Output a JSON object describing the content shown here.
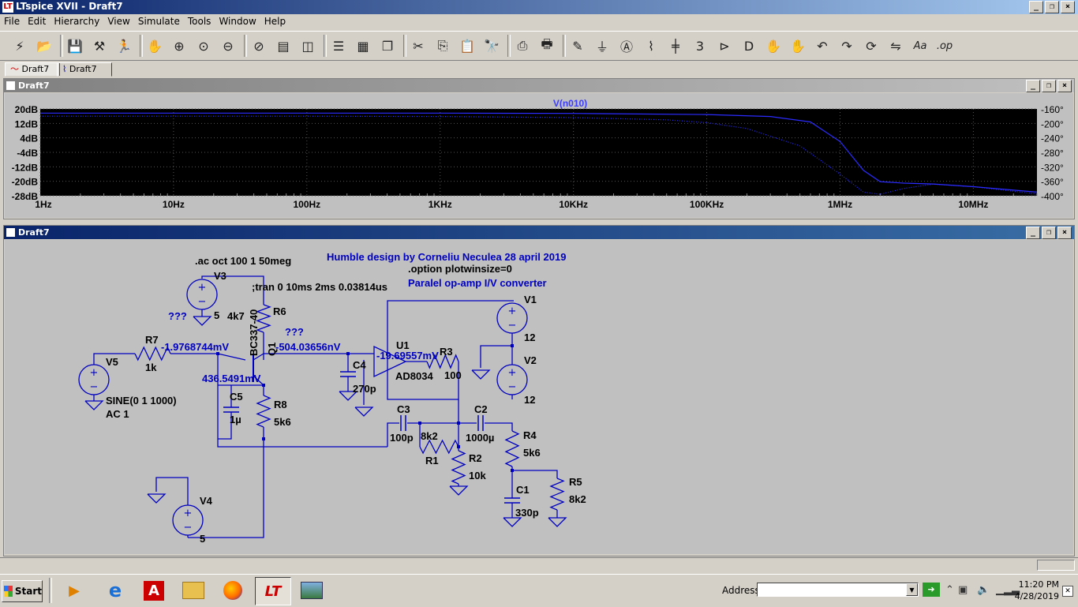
{
  "window": {
    "title": "LTspice XVII - Draft7"
  },
  "menu": [
    "File",
    "Edit",
    "Hierarchy",
    "View",
    "Simulate",
    "Tools",
    "Window",
    "Help"
  ],
  "toolbar": {
    "icons": [
      "run-icon",
      "open-icon",
      "save-icon",
      "control-panel-icon",
      "halt-icon",
      "pan-icon",
      "zoom-in-icon",
      "zoom-full-icon",
      "zoom-out-icon",
      "autorange-icon",
      "waveform-icon",
      "area-icon",
      "tile-horizontal-icon",
      "tile-vertical-icon",
      "cascade-icon",
      "cut-icon",
      "copy-icon",
      "paste-icon",
      "find-icon",
      "print-setup-icon",
      "print-icon",
      "draw-wire-icon",
      "ground-icon",
      "label-net-icon",
      "resistor-icon",
      "capacitor-icon",
      "inductor-icon",
      "diode-icon",
      "component-icon",
      "move-icon",
      "drag-icon",
      "undo-icon",
      "redo-icon",
      "rotate-icon",
      "mirror-icon",
      "text-icon",
      "spice-directive-icon"
    ]
  },
  "tabs": [
    {
      "label": "Draft7",
      "icon": "waveform-tab-icon"
    },
    {
      "label": "Draft7",
      "icon": "schematic-tab-icon"
    }
  ],
  "plot_window": {
    "title": "Draft7"
  },
  "schematic_window": {
    "title": "Draft7"
  },
  "chart_data": {
    "type": "line",
    "title": "V(n010)",
    "x_scale": "log",
    "xlim": [
      1,
      30000000
    ],
    "x_ticks": [
      "1Hz",
      "10Hz",
      "100Hz",
      "1KHz",
      "10KHz",
      "100KHz",
      "1MHz",
      "10MHz"
    ],
    "x_tick_values": [
      1,
      10,
      100,
      1000,
      10000,
      100000,
      1000000,
      10000000
    ],
    "ylim_left": [
      -28,
      20
    ],
    "y_ticks_left": [
      "20dB",
      "12dB",
      "4dB",
      "-4dB",
      "-12dB",
      "-20dB",
      "-28dB"
    ],
    "y_tick_values_left": [
      20,
      12,
      4,
      -4,
      -12,
      -20,
      -28
    ],
    "ylim_right": [
      -400,
      -160
    ],
    "y_ticks_right": [
      "-160°",
      "-200°",
      "-240°",
      "-280°",
      "-320°",
      "-360°",
      "-400°"
    ],
    "y_tick_values_right": [
      -160,
      -200,
      -240,
      -280,
      -320,
      -360,
      -400
    ],
    "series": [
      {
        "role": "magnitude",
        "style": "solid",
        "x": [
          1,
          10,
          100,
          1000,
          10000,
          100000,
          300000,
          600000,
          1000000,
          1500000,
          2000000,
          3000000,
          5000000,
          10000000,
          30000000
        ],
        "values": [
          17.7,
          17.7,
          17.7,
          17.7,
          17.5,
          16.9,
          15.8,
          12.8,
          2.0,
          -14.0,
          -20.2,
          -21.0,
          -21.5,
          -23.0,
          -26.0
        ]
      },
      {
        "role": "phase",
        "style": "dotted",
        "x": [
          1,
          10,
          100,
          1000,
          10000,
          50000,
          100000,
          200000,
          500000,
          1000000,
          1500000,
          2000000,
          3000000,
          5000000,
          10000000,
          30000000
        ],
        "values": [
          -180,
          -180,
          -180,
          -181,
          -184,
          -190,
          -198,
          -214,
          -262,
          -340,
          -390,
          -396,
          -380,
          -368,
          -375,
          -395
        ]
      }
    ],
    "colors": {
      "background": "#000000",
      "grid": "#555555",
      "trace": "#2b2bff",
      "title": "#3c3cff"
    }
  },
  "schematic": {
    "texts": {
      "directive_ac": ".ac oct 100 1 50meg",
      "title_note": "Humble design by Corneliu Neculea 28 april 2019",
      "option": ".option plotwinsize=0",
      "tran": ";tran 0 10ms 2ms 0.03814us",
      "subtitle": "Paralel op-amp I/V converter",
      "V3": "V3",
      "V3_val": "5",
      "R6": "R6",
      "R6_val": "4k7",
      "Q1_model": "BC337-40",
      "Q1": "Q1",
      "V1": "V1",
      "V1_val": "12",
      "V2": "V2",
      "V2_val": "12",
      "U1": "U1",
      "U1_model": "AD8034",
      "R3": "R3",
      "R3_val": "100",
      "R7": "R7",
      "R7_val": "1k",
      "V5": "V5",
      "V5_val": "SINE(0 1 1000)",
      "V5_ac": "AC 1",
      "C5": "C5",
      "C5_val": "1µ",
      "R8": "R8",
      "R8_val": "5k6",
      "C4": "C4",
      "C4_val": "270p",
      "C3": "C3",
      "C3_val": "100p",
      "R1": "R1",
      "R1_val": "8k2",
      "C2": "C2",
      "C2_val": "1000µ",
      "R2": "R2",
      "R2_val": "10k",
      "R4": "R4",
      "R4_val": "5k6",
      "R5": "R5",
      "R5_val": "8k2",
      "C1": "C1",
      "C1_val": "330p",
      "V4": "V4",
      "V4_val": "5",
      "probe_1": "???",
      "probe_2": "???",
      "v_n1": "-1.9768744mV",
      "v_n2": "-504.03656nV",
      "v_n3": "-19.69557mV",
      "v_n4": "436.5491mV"
    },
    "colors": {
      "wire": "#0000c0",
      "text": "#000000",
      "annotation": "#0000c0",
      "background": "#c0c0c0"
    }
  },
  "taskbar": {
    "start_label": "Start",
    "apps": [
      "media-player-icon",
      "internet-explorer-icon",
      "acrobat-icon",
      "file-explorer-icon",
      "firefox-icon",
      "ltspice-icon",
      "picture-viewer-icon"
    ],
    "address_label": "Address",
    "address_value": "",
    "time": "11:20 PM",
    "date": "4/28/2019"
  }
}
